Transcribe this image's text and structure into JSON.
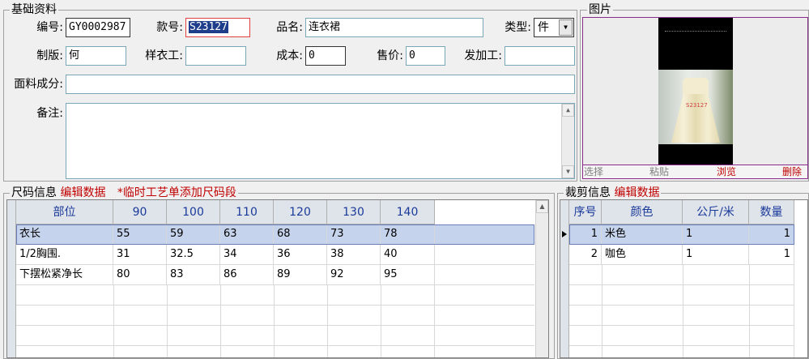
{
  "basic": {
    "title": "基础资料",
    "code_label": "编号:",
    "code_value": "GY0002987",
    "style_label": "款号:",
    "style_value": "S23127",
    "name_label": "品名:",
    "name_value": "连衣裙",
    "type_label": "类型:",
    "type_value": "件",
    "pattern_label": "制版:",
    "pattern_value": "何",
    "sample_label": "样衣工:",
    "sample_value": "",
    "cost_label": "成本:",
    "cost_value": "0",
    "price_label": "售价:",
    "price_value": "0",
    "outsource_label": "发加工:",
    "outsource_value": "",
    "fabric_label": "面料成分:",
    "fabric_value": "",
    "remark_label": "备注:",
    "remark_value": ""
  },
  "picture": {
    "title": "图片",
    "select_label": "选择",
    "paste_label": "粘贴",
    "browse_label": "浏览",
    "delete_label": "删除",
    "photo_tag": "S23127",
    "colors": {
      "btn_gray": "#808080",
      "btn_red": "#c00000"
    }
  },
  "size": {
    "title": "尺码信息",
    "edit_label": "编辑数据",
    "add_label": "*临时工艺单添加尺码段",
    "columns": [
      "部位",
      "90",
      "100",
      "110",
      "120",
      "130",
      "140"
    ],
    "rows": [
      [
        "衣长",
        "55",
        "59",
        "63",
        "68",
        "73",
        "78"
      ],
      [
        "1/2胸围.",
        "31",
        "32.5",
        "34",
        "36",
        "38",
        "40"
      ],
      [
        "下摆松紧净长",
        "80",
        "83",
        "86",
        "89",
        "92",
        "95"
      ]
    ]
  },
  "cut": {
    "title": "裁剪信息",
    "edit_label": "编辑数据",
    "columns": [
      "序号",
      "颜色",
      "公斤/米",
      "数量"
    ],
    "rows": [
      [
        "1",
        "米色",
        "1",
        "1"
      ],
      [
        "2",
        "咖色",
        "1",
        "1"
      ]
    ]
  },
  "colors": {
    "accent_red": "#c00000",
    "header_blue": "#1a3a9a",
    "row_selected": "#c5d4ec"
  }
}
